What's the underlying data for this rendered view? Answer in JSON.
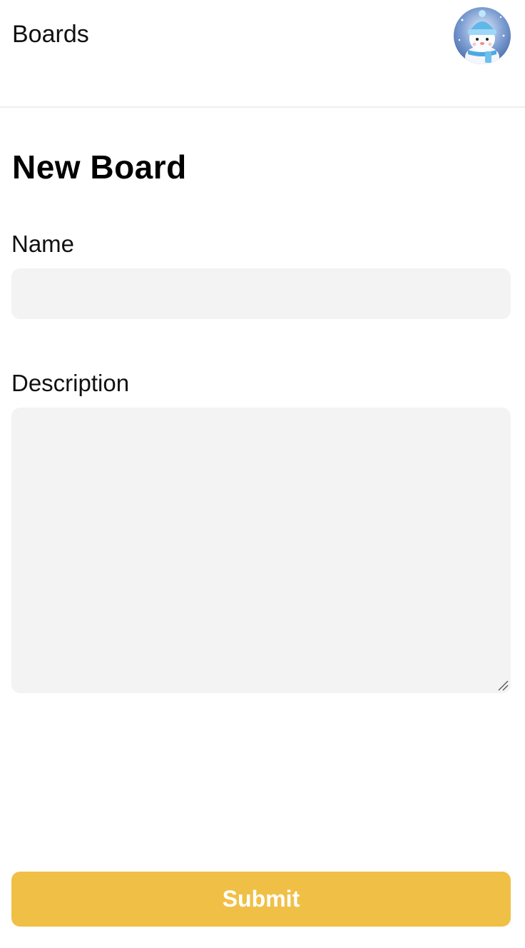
{
  "header": {
    "title": "Boards",
    "avatar_icon": "snowman-avatar-icon"
  },
  "form": {
    "title": "New Board",
    "name_label": "Name",
    "name_value": "",
    "description_label": "Description",
    "description_value": "",
    "submit_label": "Submit"
  },
  "colors": {
    "accent": "#f0c046",
    "input_background": "#f3f3f3",
    "divider": "#eeeeee"
  }
}
